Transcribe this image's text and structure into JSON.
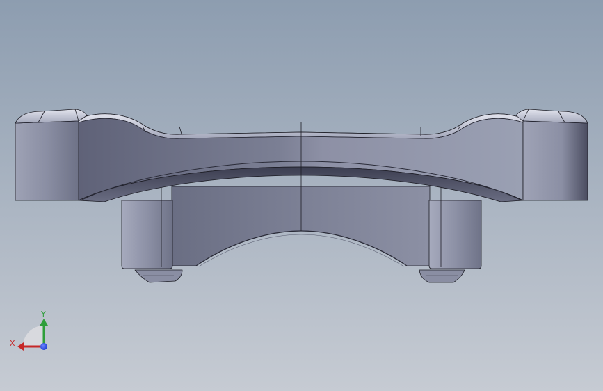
{
  "viewport": {
    "background_top": "#8d9db0",
    "background_bottom": "#c6cbd3"
  },
  "part": {
    "name": "bracket-part",
    "body_color": "#7f8499",
    "body_light": "#a9adc0",
    "body_dark": "#4f5266",
    "edge_color": "#1c1c24",
    "highlight": "#e8e9f1"
  },
  "triad": {
    "x_label": "X",
    "y_label": "Y",
    "x_color": "#c62828",
    "y_color": "#2e9e3a",
    "z_color": "#1f3fd6"
  }
}
